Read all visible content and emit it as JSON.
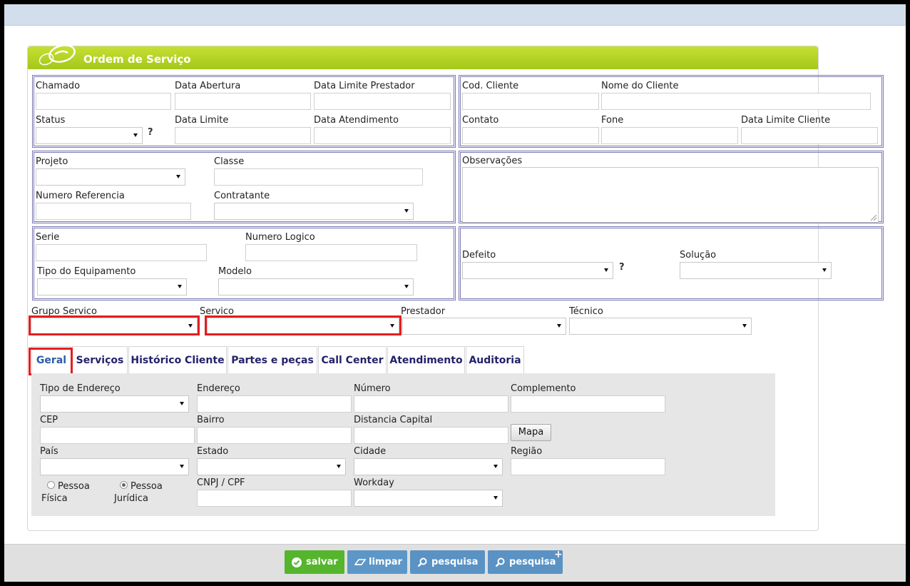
{
  "form_title": "Ordem de Serviço",
  "section1_left": {
    "chamado": "Chamado",
    "data_abertura": "Data Abertura",
    "data_limite_prestador": "Data Limite Prestador",
    "status": "Status",
    "data_limite": "Data Limite",
    "data_atendimento": "Data Atendimento",
    "help": "?"
  },
  "section1_right": {
    "cod_cliente": "Cod. Cliente",
    "nome_cliente": "Nome do Cliente",
    "contato": "Contato",
    "fone": "Fone",
    "data_limite_cliente": "Data Limite Cliente"
  },
  "section2_left": {
    "projeto": "Projeto",
    "classe": "Classe",
    "numero_referencia": "Numero Referencia",
    "contratante": "Contratante"
  },
  "section2_right": {
    "observacoes": "Observações"
  },
  "section3_left": {
    "serie": "Serie",
    "numero_logico": "Numero Logico",
    "tipo_equipamento": "Tipo do Equipamento",
    "modelo": "Modelo"
  },
  "section3_right": {
    "defeito": "Defeito",
    "solucao": "Solução",
    "help": "?"
  },
  "service_row": {
    "grupo_servico": "Grupo Servico",
    "servico": "Servico",
    "prestador": "Prestador",
    "tecnico": "Técnico"
  },
  "tabs": [
    "Geral",
    "Serviços",
    "Histórico Cliente",
    "Partes e peças",
    "Call Center",
    "Atendimento",
    "Auditoria"
  ],
  "geral": {
    "tipo_endereco": "Tipo de Endereço",
    "endereco": "Endereço",
    "numero": "Número",
    "complemento": "Complemento",
    "cep": "CEP",
    "bairro": "Bairro",
    "distancia_capital": "Distancia Capital",
    "mapa_button": "Mapa",
    "pais": "País",
    "estado": "Estado",
    "cidade": "Cidade",
    "regiao": "Região",
    "pessoa_fisica_line1": "Pessoa",
    "pessoa_fisica_line2": "Física",
    "pessoa_juridica_line1": "Pessoa",
    "pessoa_juridica_line2": "Jurídica",
    "cnpj_cpf": "CNPJ / CPF",
    "workday": "Workday"
  },
  "footer_buttons": {
    "salvar": "salvar",
    "limpar": "limpar",
    "pesquisa": "pesquisa",
    "pesquisa_plus": "pesquisa",
    "plus": "+"
  },
  "colors": {
    "title_bar": "#a4c81a",
    "section_border": "#7a78b4",
    "highlight": "#e21e1e",
    "btn_salvar": "#55b52c",
    "btn_limpar": "#5d97c7",
    "btn_pesquisa": "#5a92c4",
    "tab_text": "#23226a"
  }
}
